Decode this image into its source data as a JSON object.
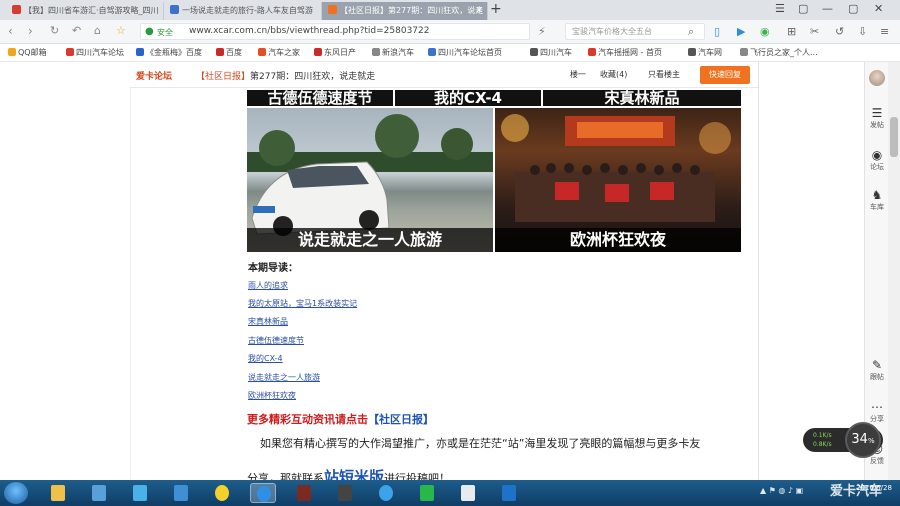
{
  "browser": {
    "tabs": [
      {
        "label": "【我】四川省车游汇·自驾游攻略_四川",
        "color": "#d93a2f",
        "active": false
      },
      {
        "label": "一场说走就走的旅行-路人车友自驾游",
        "color": "#3a73c9",
        "active": false
      },
      {
        "label": "【社区日报】第277期：四川狂欢，说走",
        "color": "#f0721f",
        "active": true
      }
    ],
    "new_tab": "+",
    "window_controls": [
      "☰",
      "▢",
      "—",
      "▢",
      "✕"
    ],
    "url_hint": "安全",
    "url": "www.xcar.com.cn/bbs/viewthread.php?tid=25803722",
    "search_placeholder": "宝骏汽车价格大全五台",
    "bookmarks": [
      {
        "label": "QQ邮箱",
        "color": "#f0a81a"
      },
      {
        "label": "四川汽车论坛",
        "color": "#d93a2f"
      },
      {
        "label": "《金瓶梅》百度",
        "color": "#2b64c9"
      },
      {
        "label": "百度",
        "color": "#c92b2b"
      },
      {
        "label": "汽车之家",
        "color": "#e54d26"
      },
      {
        "label": "东风日产",
        "color": "#c92b2b"
      },
      {
        "label": "新浪汽车",
        "color": "#888"
      },
      {
        "label": "四川汽车论坛首页",
        "color": "#3a73c9"
      },
      {
        "label": "四川汽车",
        "color": "#555"
      },
      {
        "label": "汽车摇摇网 - 首页",
        "color": "#d93a2f"
      },
      {
        "label": "汽车网",
        "color": "#555"
      },
      {
        "label": "飞行员之家_个人...",
        "color": "#888"
      }
    ]
  },
  "site": {
    "brand": "爱卡论坛",
    "thread_title_prefix": "【社区日报】",
    "thread_title": "第277期：四川狂欢，说走就走",
    "links": [
      "楼一",
      "收藏(4)",
      "只看楼主"
    ],
    "reply_button": "快速回复"
  },
  "post": {
    "strip_titles": [
      "古德伍德速度节",
      "我的CX-4",
      "宋真林新品"
    ],
    "photo_captions": [
      "说走就走之一人旅游",
      "欧洲杯狂欢夜"
    ],
    "intro_heading": "本期导读：",
    "toc": [
      "雨人的追求",
      "我的太原站，宝马1系改装实记",
      "宋真林新品",
      "古德伍德速度节",
      "我的CX-4",
      "说走就走之一人旅游",
      "欧洲杯狂欢夜"
    ],
    "promo_text": "更多精彩互动资讯请点击",
    "promo_link": "【社区日报】",
    "para1": "如果您有精心撰写的大作渴望推广，亦或是在茫茫“站”海里发现了亮眼的篇幅想与更多卡友",
    "para2_prefix": "分享，那就联系",
    "para2_highlight": "站短米版",
    "para2_suffix": "进行投稿吧！"
  },
  "sidebar": {
    "items": [
      {
        "icon": "☰",
        "label": "发帖"
      },
      {
        "icon": "◉",
        "label": "论坛"
      },
      {
        "icon": "♞",
        "label": "车库"
      },
      {
        "icon": "✎",
        "label": "跟帖"
      },
      {
        "icon": "⋯",
        "label": "分享"
      },
      {
        "icon": "☺",
        "label": "反馈"
      }
    ]
  },
  "speed_widget": {
    "up": "0.1K/s",
    "down": "0.8K/s",
    "percent": "34"
  },
  "taskbar": {
    "apps": [
      {
        "name": "explorer",
        "color": "#f0c048"
      },
      {
        "name": "control-panel",
        "color": "#5aa0d8"
      },
      {
        "name": "qq-browser",
        "color": "#49b2e8"
      },
      {
        "name": "media",
        "color": "#3f8fd4"
      },
      {
        "name": "qq",
        "color": "#f5d028"
      },
      {
        "name": "browser",
        "color": "#2f8fe6",
        "active": true
      },
      {
        "name": "game",
        "color": "#7a2a1f"
      },
      {
        "name": "media-player",
        "color": "#444"
      },
      {
        "name": "ie",
        "color": "#3aa3ea"
      },
      {
        "name": "iqiyi",
        "color": "#28b84a"
      },
      {
        "name": "notepad",
        "color": "#e9ecef"
      },
      {
        "name": "book",
        "color": "#1e73c8"
      }
    ],
    "clock_time": "爱卡汽车",
    "clock_date": "2016/6/28"
  }
}
